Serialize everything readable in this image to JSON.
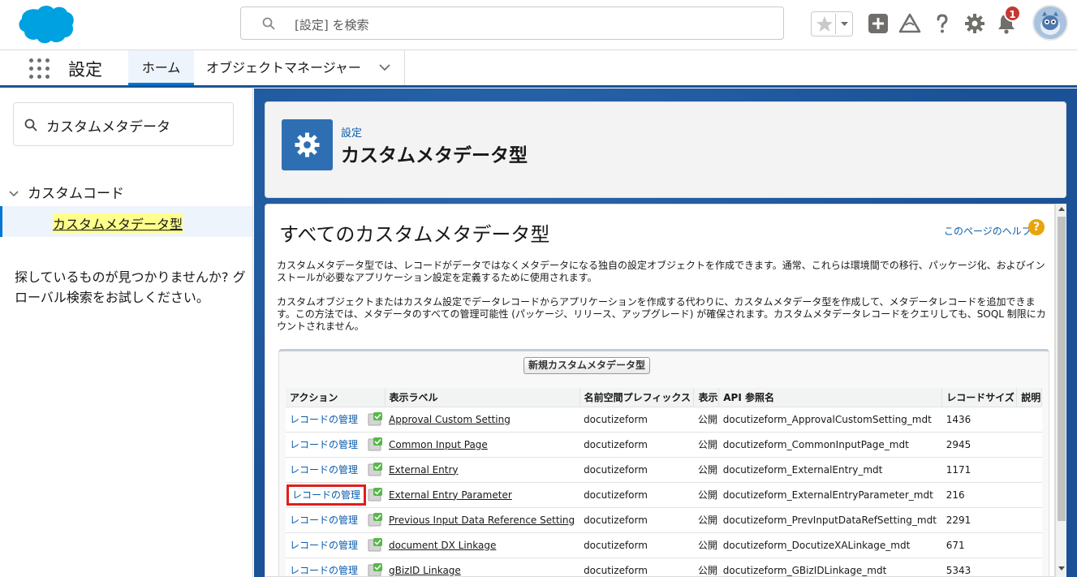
{
  "header": {
    "search_placeholder": "[設定] を検索",
    "notifications_count": "1",
    "icons": [
      "salesforce-logo",
      "favorites-star-icon",
      "add-icon",
      "trailhead-icon",
      "help-icon",
      "gear-icon",
      "bell-icon",
      "avatar"
    ]
  },
  "nav": {
    "app_name": "設定",
    "tabs": [
      {
        "label": "ホーム",
        "active": true
      },
      {
        "label": "オブジェクトマネージャー",
        "active": false
      }
    ]
  },
  "sidebar": {
    "quickfind_value": "カスタムメタデータ",
    "tree_section": "カスタムコード",
    "tree_item": "カスタムメタデータ型",
    "not_found_text": "探しているものが見つかりませんか? グローバル検索をお試しください。"
  },
  "page_header": {
    "breadcrumb": "設定",
    "title": "カスタムメタデータ型"
  },
  "content": {
    "title": "すべてのカスタムメタデータ型",
    "help_link": "このページのヘルプ",
    "description1": "カスタムメタデータ型では、レコードがデータではなくメタデータになる独自の設定オブジェクトを作成できます。通常、これらは環境間での移行、パッケージ化、およびインストールが必要なアプリケーション設定を定義するために使用されます。",
    "description2": "カスタムオブジェクトまたはカスタム設定でデータレコードからアプリケーションを作成する代わりに、カスタムメタデータ型を作成して、メタデータレコードを追加できます。この方法では、メタデータのすべての管理可能性 (パッケージ、リリース、アップグレード) が確保されます。カスタムメタデータレコードをクエリしても、SOQL 制限にカウントされません。",
    "new_button": "新規カスタムメタデータ型",
    "columns": [
      "アクション",
      "表示ラベル",
      "名前空間プレフィックス",
      "表示",
      "API 参照名",
      "レコードサイズ",
      "説明"
    ],
    "rows": [
      {
        "action": "レコードの管理",
        "label": "Approval Custom Setting",
        "namespace": "docutizeform",
        "visibility": "公開",
        "api_name": "docutizeform_ApprovalCustomSetting_mdt",
        "size": "1436",
        "desc": ""
      },
      {
        "action": "レコードの管理",
        "label": "Common Input Page",
        "namespace": "docutizeform",
        "visibility": "公開",
        "api_name": "docutizeform_CommonInputPage_mdt",
        "size": "2945",
        "desc": ""
      },
      {
        "action": "レコードの管理",
        "label": "External Entry",
        "namespace": "docutizeform",
        "visibility": "公開",
        "api_name": "docutizeform_ExternalEntry_mdt",
        "size": "1171",
        "desc": ""
      },
      {
        "action": "レコードの管理",
        "label": "External Entry Parameter",
        "namespace": "docutizeform",
        "visibility": "公開",
        "api_name": "docutizeform_ExternalEntryParameter_mdt",
        "size": "216",
        "desc": "",
        "highlighted": true
      },
      {
        "action": "レコードの管理",
        "label": "Previous Input Data Reference Setting",
        "namespace": "docutizeform",
        "visibility": "公開",
        "api_name": "docutizeform_PrevInputDataRefSetting_mdt",
        "size": "2291",
        "desc": ""
      },
      {
        "action": "レコードの管理",
        "label": "document DX Linkage",
        "namespace": "docutizeform",
        "visibility": "公開",
        "api_name": "docutizeform_DocutizeXALinkage_mdt",
        "size": "671",
        "desc": ""
      },
      {
        "action": "レコードの管理",
        "label": "gBizID Linkage",
        "namespace": "docutizeform",
        "visibility": "公開",
        "api_name": "docutizeform_GBizIDLinkage_mdt",
        "size": "5343",
        "desc": ""
      }
    ]
  },
  "colors": {
    "brand_blue": "#0176d3",
    "link_blue": "#0b5cab",
    "highlight_red": "#e01e1e",
    "badge_red": "#c23934"
  }
}
